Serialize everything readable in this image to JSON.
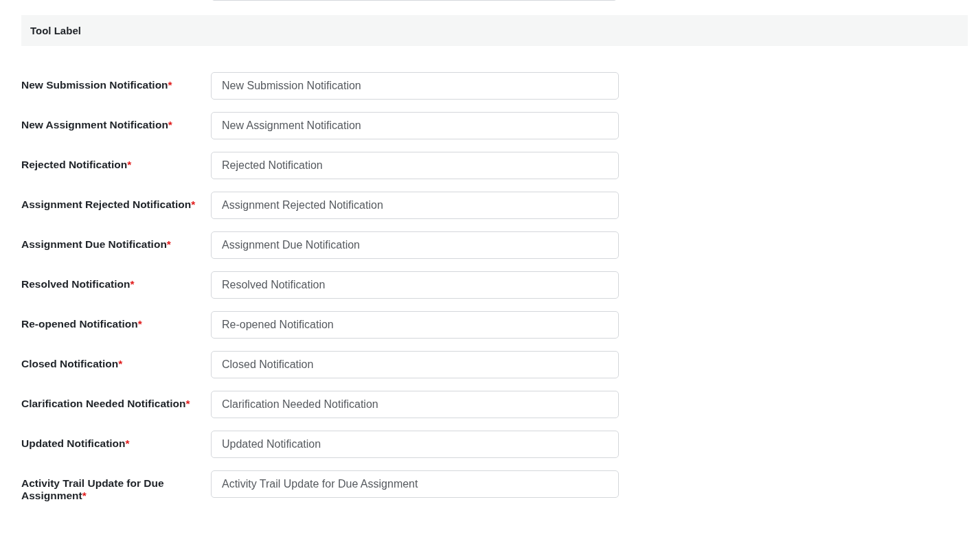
{
  "section": {
    "title": "Tool Label"
  },
  "fields": [
    {
      "label": "New Submission Notification",
      "required_mark": "*",
      "value": "New Submission Notification"
    },
    {
      "label": "New Assignment Notification",
      "required_mark": "*",
      "value": "New Assignment Notification"
    },
    {
      "label": "Rejected Notification",
      "required_mark": "*",
      "value": "Rejected Notification"
    },
    {
      "label": "Assignment Rejected Notification",
      "required_mark": "*",
      "value": "Assignment Rejected Notification"
    },
    {
      "label": "Assignment Due Notification",
      "required_mark": "*",
      "value": "Assignment Due Notification"
    },
    {
      "label": "Resolved Notification",
      "required_mark": "*",
      "value": "Resolved Notification"
    },
    {
      "label": "Re-opened Notification",
      "required_mark": "*",
      "value": "Re-opened Notification"
    },
    {
      "label": "Closed Notification",
      "required_mark": "*",
      "value": "Closed Notification"
    },
    {
      "label": "Clarification Needed Notification",
      "required_mark": "*",
      "value": "Clarification Needed Notification"
    },
    {
      "label": "Updated Notification",
      "required_mark": "*",
      "value": "Updated Notification"
    },
    {
      "label": "Activity Trail Update for Due Assignment",
      "required_mark": "*",
      "value": "Activity Trail Update for Due Assignment"
    }
  ]
}
